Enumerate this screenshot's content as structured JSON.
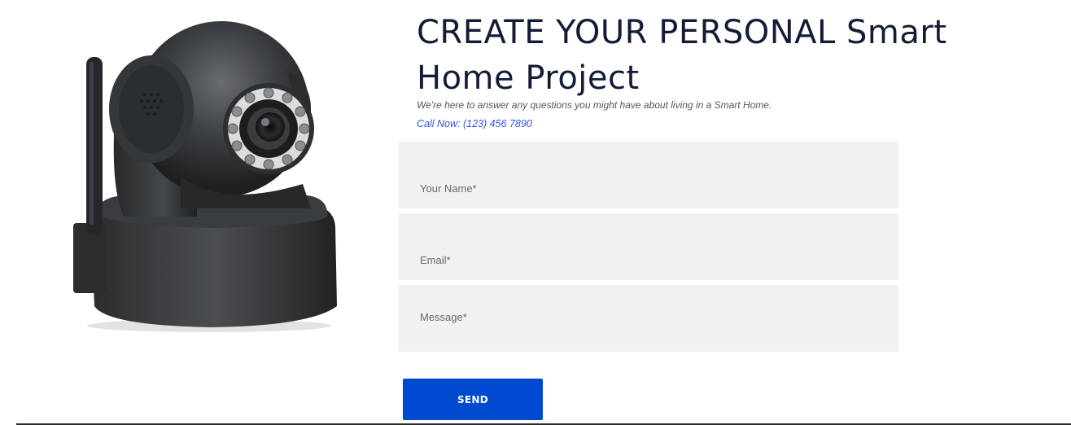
{
  "hero": {
    "title": "CREATE YOUR PERSONAL Smart Home Project",
    "subtitle": "We're here to answer any questions you might have about living in a Smart Home.",
    "phone": "Call Now: (123) 456 7890"
  },
  "form": {
    "name_placeholder": "Your Name*",
    "email_placeholder": "Email*",
    "message_placeholder": "Message*",
    "send_label": "SEND"
  },
  "colors": {
    "title": "#131c36",
    "link": "#2f56e0",
    "field_bg": "#f1f1f1",
    "button": "#0049d1"
  },
  "image": {
    "icon": "ip-camera-image"
  }
}
